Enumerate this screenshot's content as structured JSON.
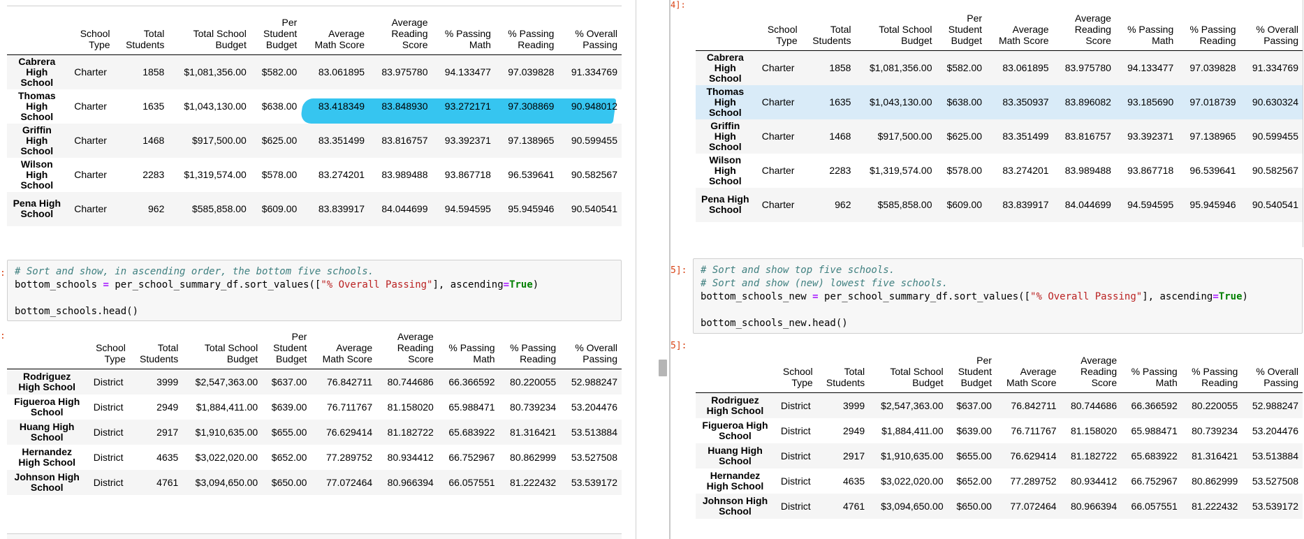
{
  "columns": [
    "School Type",
    "Total Students",
    "Total School Budget",
    "Per Student Budget",
    "Average Math Score",
    "Average Reading Score",
    "% Passing Math",
    "% Passing Reading",
    "% Overall Passing"
  ],
  "left": {
    "top_table": [
      {
        "name": "Cabrera High School",
        "type": "Charter",
        "students": "1858",
        "budget": "$1,081,356.00",
        "per": "$582.00",
        "math": "83.061895",
        "reading": "83.975780",
        "pmath": "94.133477",
        "pread": "97.039828",
        "overall": "91.334769"
      },
      {
        "name": "Thomas High School",
        "type": "Charter",
        "students": "1635",
        "budget": "$1,043,130.00",
        "per": "$638.00",
        "math": "83.418349",
        "reading": "83.848930",
        "pmath": "93.272171",
        "pread": "97.308869",
        "overall": "90.948012"
      },
      {
        "name": "Griffin High School",
        "type": "Charter",
        "students": "1468",
        "budget": "$917,500.00",
        "per": "$625.00",
        "math": "83.351499",
        "reading": "83.816757",
        "pmath": "93.392371",
        "pread": "97.138965",
        "overall": "90.599455"
      },
      {
        "name": "Wilson High School",
        "type": "Charter",
        "students": "2283",
        "budget": "$1,319,574.00",
        "per": "$578.00",
        "math": "83.274201",
        "reading": "83.989488",
        "pmath": "93.867718",
        "pread": "96.539641",
        "overall": "90.582567"
      },
      {
        "name": "Pena High School",
        "type": "Charter",
        "students": "962",
        "budget": "$585,858.00",
        "per": "$609.00",
        "math": "83.839917",
        "reading": "84.044699",
        "pmath": "94.594595",
        "pread": "95.945946",
        "overall": "90.540541"
      }
    ],
    "code": {
      "line1": "# Sort and show, in ascending order, the bottom five schools.",
      "line2_var": "bottom_schools",
      "line2_mid": " = per_school_summary_df.sort_values([",
      "line2_str": "\"% Overall Passing\"",
      "line2_end1": "], ascending",
      "line2_true": "True",
      "line2_close": ")",
      "line4": "bottom_schools.head()"
    },
    "bottom_table": [
      {
        "name": "Rodriguez High School",
        "type": "District",
        "students": "3999",
        "budget": "$2,547,363.00",
        "per": "$637.00",
        "math": "76.842711",
        "reading": "80.744686",
        "pmath": "66.366592",
        "pread": "80.220055",
        "overall": "52.988247"
      },
      {
        "name": "Figueroa High School",
        "type": "District",
        "students": "2949",
        "budget": "$1,884,411.00",
        "per": "$639.00",
        "math": "76.711767",
        "reading": "81.158020",
        "pmath": "65.988471",
        "pread": "80.739234",
        "overall": "53.204476"
      },
      {
        "name": "Huang High School",
        "type": "District",
        "students": "2917",
        "budget": "$1,910,635.00",
        "per": "$655.00",
        "math": "76.629414",
        "reading": "81.182722",
        "pmath": "65.683922",
        "pread": "81.316421",
        "overall": "53.513884"
      },
      {
        "name": "Hernandez High School",
        "type": "District",
        "students": "4635",
        "budget": "$3,022,020.00",
        "per": "$652.00",
        "math": "77.289752",
        "reading": "80.934412",
        "pmath": "66.752967",
        "pread": "80.862999",
        "overall": "53.527508"
      },
      {
        "name": "Johnson High School",
        "type": "District",
        "students": "4761",
        "budget": "$3,094,650.00",
        "per": "$650.00",
        "math": "77.072464",
        "reading": "80.966394",
        "pmath": "66.057551",
        "pread": "81.222432",
        "overall": "53.539172"
      }
    ]
  },
  "right": {
    "prompt_top": "4]:",
    "prompt_code": "5]:",
    "prompt_out": "5]:",
    "top_table": [
      {
        "name": "Cabrera High School",
        "type": "Charter",
        "students": "1858",
        "budget": "$1,081,356.00",
        "per": "$582.00",
        "math": "83.061895",
        "reading": "83.975780",
        "pmath": "94.133477",
        "pread": "97.039828",
        "overall": "91.334769"
      },
      {
        "name": "Thomas High School",
        "type": "Charter",
        "students": "1635",
        "budget": "$1,043,130.00",
        "per": "$638.00",
        "math": "83.350937",
        "reading": "83.896082",
        "pmath": "93.185690",
        "pread": "97.018739",
        "overall": "90.630324"
      },
      {
        "name": "Griffin High School",
        "type": "Charter",
        "students": "1468",
        "budget": "$917,500.00",
        "per": "$625.00",
        "math": "83.351499",
        "reading": "83.816757",
        "pmath": "93.392371",
        "pread": "97.138965",
        "overall": "90.599455"
      },
      {
        "name": "Wilson High School",
        "type": "Charter",
        "students": "2283",
        "budget": "$1,319,574.00",
        "per": "$578.00",
        "math": "83.274201",
        "reading": "83.989488",
        "pmath": "93.867718",
        "pread": "96.539641",
        "overall": "90.582567"
      },
      {
        "name": "Pena High School",
        "type": "Charter",
        "students": "962",
        "budget": "$585,858.00",
        "per": "$609.00",
        "math": "83.839917",
        "reading": "84.044699",
        "pmath": "94.594595",
        "pread": "95.945946",
        "overall": "90.540541"
      }
    ],
    "code": {
      "line1": "# Sort and show top five schools.",
      "line2": "# Sort and show (new) lowest five schools.",
      "line3_var": "bottom_schools_new",
      "line3_mid": " = per_school_summary_df.sort_values([",
      "line3_str": "\"% Overall Passing\"",
      "line3_end1": "], ascending",
      "line3_true": "True",
      "line3_close": ")",
      "line5": "bottom_schools_new.head()"
    },
    "bottom_table": [
      {
        "name": "Rodriguez High School",
        "type": "District",
        "students": "3999",
        "budget": "$2,547,363.00",
        "per": "$637.00",
        "math": "76.842711",
        "reading": "80.744686",
        "pmath": "66.366592",
        "pread": "80.220055",
        "overall": "52.988247"
      },
      {
        "name": "Figueroa High School",
        "type": "District",
        "students": "2949",
        "budget": "$1,884,411.00",
        "per": "$639.00",
        "math": "76.711767",
        "reading": "81.158020",
        "pmath": "65.988471",
        "pread": "80.739234",
        "overall": "53.204476"
      },
      {
        "name": "Huang High School",
        "type": "District",
        "students": "2917",
        "budget": "$1,910,635.00",
        "per": "$655.00",
        "math": "76.629414",
        "reading": "81.182722",
        "pmath": "65.683922",
        "pread": "81.316421",
        "overall": "53.513884"
      },
      {
        "name": "Hernandez High School",
        "type": "District",
        "students": "4635",
        "budget": "$3,022,020.00",
        "per": "$652.00",
        "math": "77.289752",
        "reading": "80.934412",
        "pmath": "66.752967",
        "pread": "80.862999",
        "overall": "53.527508"
      },
      {
        "name": "Johnson High School",
        "type": "District",
        "students": "4761",
        "budget": "$3,094,650.00",
        "per": "$650.00",
        "math": "77.072464",
        "reading": "80.966394",
        "pmath": "66.057551",
        "pread": "81.222432",
        "overall": "53.539172"
      }
    ]
  },
  "colors": {
    "highlight": "#36c5f0",
    "selected_row": "#d9ebf8",
    "prompt": "#d84315"
  }
}
